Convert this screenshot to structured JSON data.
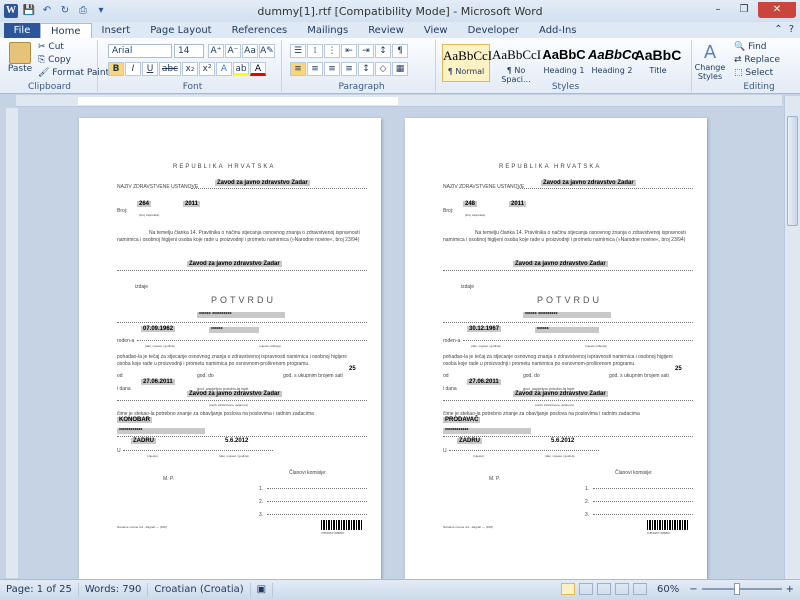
{
  "window": {
    "title": "dummy[1].rtf [Compatibility Mode] - Microsoft Word",
    "minimize": "–",
    "restore": "❐",
    "close": "✕"
  },
  "qat": {
    "logo": "W",
    "save": "💾",
    "undo": "↶",
    "redo": "↻",
    "print": "⎙",
    "customize": "▾"
  },
  "tabs": [
    "File",
    "Home",
    "Insert",
    "Page Layout",
    "References",
    "Mailings",
    "Review",
    "View",
    "Developer",
    "Add-Ins"
  ],
  "tab_right": {
    "collapse": "⌃",
    "help": "?"
  },
  "ribbon": {
    "clipboard": {
      "label": "Clipboard",
      "paste": "Paste",
      "cut": "Cut",
      "copy": "Copy",
      "format_painter": "Format Painter"
    },
    "font": {
      "label": "Font",
      "name": "Arial",
      "size": "14",
      "grow": "A⁺",
      "shrink": "A⁻",
      "change_case": "Aa",
      "clear": "A✎",
      "bold": "B",
      "italic": "I",
      "underline": "U",
      "strike": "abc",
      "sub": "x₂",
      "sup": "x²",
      "effects": "A",
      "highlight": "ab",
      "color": "A"
    },
    "paragraph": {
      "label": "Paragraph",
      "bullets": "☰",
      "numbering": "⁞",
      "multilevel": "⋮",
      "dec_indent": "⇤",
      "inc_indent": "⇥",
      "sort": "↕",
      "pilcrow": "¶",
      "align_left": "≡",
      "center": "≡",
      "align_right": "≡",
      "justify": "≡",
      "spacing": "↕",
      "shading": "◇",
      "borders": "▦"
    },
    "styles": {
      "label": "Styles",
      "items": [
        {
          "preview": "AaBbCcI",
          "name": "¶ Normal"
        },
        {
          "preview": "AaBbCcI",
          "name": "¶ No Spaci..."
        },
        {
          "preview": "AaBbC",
          "name": "Heading 1"
        },
        {
          "preview": "AaBbCc",
          "name": "Heading 2"
        },
        {
          "preview": "AaBbC",
          "name": "Title"
        }
      ],
      "change_styles": "Change Styles"
    },
    "editing": {
      "label": "Editing",
      "find": "Find",
      "replace": "Replace",
      "select": "Select"
    }
  },
  "document": {
    "pages": [
      {
        "republic": "REPUBLIKA HRVATSKA",
        "institution_label": "NAZIV ZDRAVSTVENE USTANOVE",
        "institution": "Zavod za javno zdravstvo Zadar",
        "broj_label": "Broj:",
        "broj": "264",
        "year": "2011",
        "broj_sub": "(broj zapisnika)",
        "legal_text_1": "Na temelju članka 14. Pravilnika o načinu stjecanja osnovnog znanja o zdravstvenoj ispravnosti",
        "legal_text_2": "namirnica i osobnoj higijeni osoba koje rade u proizvodnji i prometu namirnica (»Narodne novine«, broj 23/94)",
        "issuer": "Zavod za javno zdravstvo Zadar",
        "izdaje": "izdaje",
        "potvrdu": "POTVRDU",
        "name": "****** **********",
        "dob": "07.09.1962",
        "place": "******",
        "rodjen": "rođen-a",
        "rodjen_sub": "(dan, mjesec i godina)",
        "place_sub": "(mjesto rođenja)",
        "course_1": "pohađao-la je tečaj za stjecanje osnovnog znanja o zdravstvenoj ispravnosti namirnica i osobnoj higijeni",
        "course_2": "osoba koje rade u proizvodnji i prometu namirnica po osnovnom-proširenom programu.",
        "od": "od",
        "god_do": "god. do",
        "god_ukupno": "god. s ukupnim brojem sati",
        "hours": "25",
        "idana": "i dana",
        "exam_date": "27.06.2011",
        "exam_sub": "god. uspješno položio-la ispit",
        "exam_org": "Zavod za javno zdravstvo Zadar",
        "exam_org_sub": "(naziv zdravstvene ustanove)",
        "stekao": "čime je stekao-la potrebno znanje za obavljanje poslova na poslovima i radnim zadacima",
        "job": "KONOBAR",
        "job2": "************",
        "city": "ZADRU",
        "issue_date": "5.6.2012",
        "u": "U",
        "city_sub": "(mjesto)",
        "date_sub": "(dan, mjesec i godina)",
        "mp": "M. P.",
        "commission": "Članovi komisije:",
        "c1": "1.",
        "c2": "2.",
        "c3": "3.",
        "footer": "Narodne novine d.d., Zagreb — (108)",
        "barcode_num": "3 850157 005867"
      },
      {
        "republic": "REPUBLIKA HRVATSKA",
        "institution_label": "NAZIV ZDRAVSTVENE USTANOVE",
        "institution": "Zavod za javno zdravstvo Zadar",
        "broj_label": "Broj:",
        "broj": "248",
        "year": "2011",
        "broj_sub": "(broj zapisnika)",
        "legal_text_1": "Na temelju članka 14. Pravilnika o načinu stjecanja osnovnog znanja o zdravstvenoj ispravnosti",
        "legal_text_2": "namirnica i osobnoj higijeni osoba koje rade u proizvodnji i prometu namirnica (»Narodne novine«, broj 23/94)",
        "issuer": "Zavod za javno zdravstvo Zadar",
        "izdaje": "izdaje",
        "potvrdu": "POTVRDU",
        "name": "****** **********",
        "dob": "30.12.1967",
        "place": "******",
        "rodjen": "rođen-a",
        "rodjen_sub": "(dan, mjesec i godina)",
        "place_sub": "(mjesto rođenja)",
        "course_1": "pohađao-la je tečaj za stjecanje osnovnog znanja o zdravstvenoj ispravnosti namirnica i osobnoj higijeni",
        "course_2": "osoba koje rade u proizvodnji i prometu namirnica po osnovnom-proširenom programu.",
        "od": "od",
        "god_do": "god. do",
        "god_ukupno": "god. s ukupnim brojem sati",
        "hours": "25",
        "idana": "i dana",
        "exam_date": "27.06.2011",
        "exam_sub": "god. uspješno položio-la ispit",
        "exam_org": "Zavod za javno zdravstvo Zadar",
        "exam_org_sub": "(naziv zdravstvene ustanove)",
        "stekao": "čime je stekao-la potrebno znanje za obavljanje poslova na poslovima i radnim zadacima",
        "job": "PRODAVAČ",
        "job2": "************",
        "city": "ZADRU",
        "issue_date": "5.6.2012",
        "u": "U",
        "city_sub": "(mjesto)",
        "date_sub": "(dan, mjesec i godina)",
        "mp": "M. P.",
        "commission": "Članovi komisije:",
        "c1": "1.",
        "c2": "2.",
        "c3": "3.",
        "footer": "Narodne novine d.d., Zagreb — (108)",
        "barcode_num": "3 850157 005867"
      }
    ]
  },
  "status": {
    "page": "Page: 1 of 25",
    "words": "Words: 790",
    "language": "Croatian (Croatia)",
    "zoom": "60%",
    "zoom_out": "−",
    "zoom_in": "+"
  },
  "colors": {
    "accent": "#2b579a",
    "ribbon_bg": "#e3ebf6",
    "workspace": "#c5d3e5",
    "highlight": "#c8c8c8"
  }
}
